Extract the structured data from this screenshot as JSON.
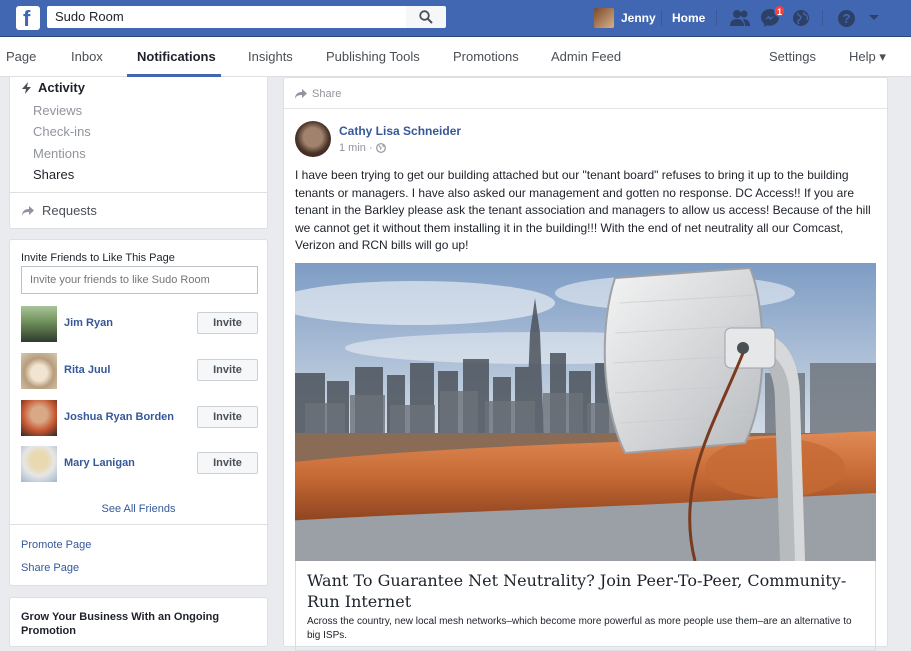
{
  "topbar": {
    "search_value": "Sudo Room",
    "user_name": "Jenny",
    "home_label": "Home",
    "messages_badge": "1",
    "brand_color": "#4267b2"
  },
  "pagenav": {
    "tabs": [
      "Page",
      "Inbox",
      "Notifications",
      "Insights",
      "Publishing Tools",
      "Promotions",
      "Admin Feed"
    ],
    "active_tab": "Notifications",
    "settings": "Settings",
    "help": "Help ▾"
  },
  "activity": {
    "header": "Activity",
    "items": [
      "Reviews",
      "Check-ins",
      "Mentions",
      "Shares"
    ],
    "requests": "Requests"
  },
  "invite": {
    "title": "Invite Friends to Like This Page",
    "placeholder": "Invite your friends to like Sudo Room",
    "button_label": "Invite",
    "friends": [
      {
        "name": "Jim Ryan"
      },
      {
        "name": "Rita Juul"
      },
      {
        "name": "Joshua Ryan Borden"
      },
      {
        "name": "Mary Lanigan"
      }
    ],
    "see_all": "See All Friends",
    "promote": "Promote Page",
    "share": "Share Page"
  },
  "grow": {
    "title": "Grow Your Business With an Ongoing Promotion"
  },
  "post": {
    "share_label": "Share",
    "author": "Cathy Lisa Schneider",
    "time": "1 min ·",
    "text": "I have been trying to get our building attached but our \"tenant board\" refuses to bring it up to the building tenants or managers. I have also asked our management and gotten no response. DC Access!! If you are tenant in the Barkley please ask the tenant association and managers to allow us access! Because of the hill we cannot get it without them installing it in the building!!! With the end of net neutrality all our Comcast, Verizon and RCN bills will go up!",
    "link_title": "Want To Guarantee Net Neutrality? Join Peer-To-Peer, Community-Run Internet",
    "link_desc": "Across the country, new local mesh networks–which become more powerful as more people use them–are an alternative to big ISPs."
  }
}
